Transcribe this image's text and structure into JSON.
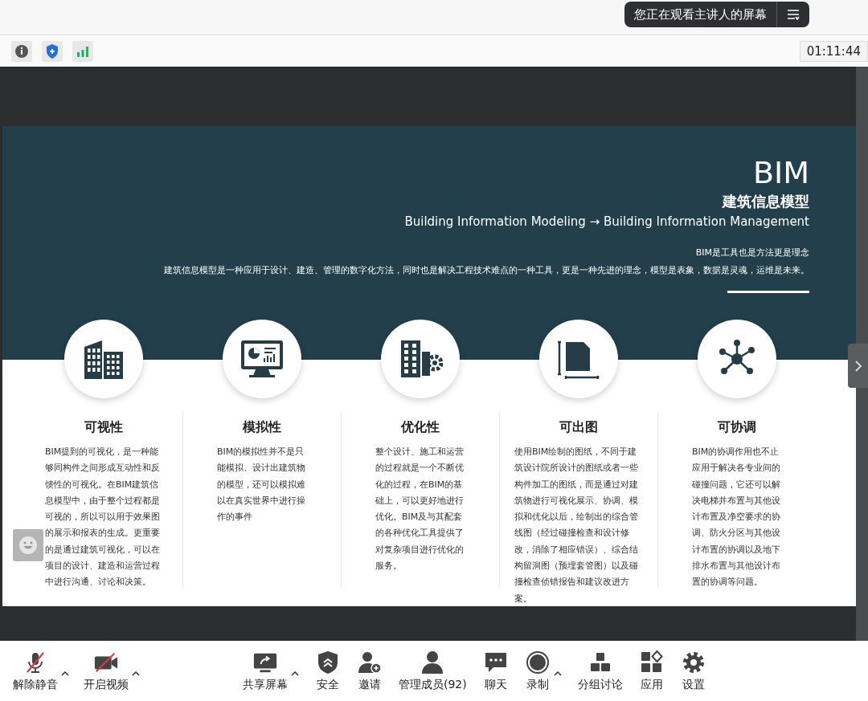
{
  "banner": {
    "text": "您正在观看主讲人的屏幕"
  },
  "timer": "01:11:44",
  "slide": {
    "title": "BIM",
    "subtitle": "建筑信息模型",
    "tagline": "Building Information Modeling → Building Information Management",
    "motto": "BIM是工具也是方法更是理念",
    "description": "建筑信息模型是一种应用于设计、建造、管理的数字化方法，同时也是解决工程技术难点的一种工具，更是一种先进的理念，模型是表象，数据是灵魂，运维是未来。",
    "features": [
      {
        "kind": "buildings",
        "title": "可视性",
        "text": "BIM提到的可视化，是一种能够同构件之间形成互动性和反馈性的可视化。在BIM建筑信息模型中，由于整个过程都是可视的，所以可以用于效果图的展示和报表的生成。更重要的是通过建筑可视化，可以在项目的设计、建造和运营过程中进行沟通、讨论和决策。"
      },
      {
        "kind": "monitor",
        "title": "模拟性",
        "text": "BIM的模拟性并不是只能模拟、设计出建筑物的模型，还可以模拟难以在真实世界中进行操作的事件"
      },
      {
        "kind": "building-gear",
        "title": "优化性",
        "text": "整个设计、施工和运营的过程就是一个不断优化的过程，在BIM的基础上，可以更好地进行优化。BIM及与其配套的各种优化工具提供了对复杂项目进行优化的服务。"
      },
      {
        "kind": "drawing",
        "title": "可出图",
        "text": "使用BIM绘制的图纸，不同于建筑设计院所设计的图纸或者一些构件加工的图纸，而是通过对建筑物进行可视化展示、协调、模拟和优化以后，绘制出的综合管线图（经过碰撞检查和设计修改，消除了相应错误）、综合结构留洞图（预埋套管图）以及碰撞检查侦错报告和建议改进方案。"
      },
      {
        "kind": "network",
        "title": "可协调",
        "text": "BIM的协调作用也不止应用于解决各专业间的碰撞问题，它还可以解决电梯井布置与其他设计布置及净空要求的协调、防火分区与其他设计布置的协调以及地下排水布置与其他设计布置的协调等问题。"
      }
    ]
  },
  "toolbar": [
    {
      "kind": "mic",
      "label": "解除静音",
      "has_menu": true
    },
    {
      "kind": "video",
      "label": "开启视频",
      "has_menu": true
    },
    {
      "kind": "share",
      "label": "共享屏幕",
      "has_menu": true
    },
    {
      "kind": "security",
      "label": "安全",
      "has_menu": false
    },
    {
      "kind": "invite",
      "label": "邀请",
      "has_menu": false
    },
    {
      "kind": "members",
      "label": "管理成员(92)",
      "has_menu": false
    },
    {
      "kind": "chat",
      "label": "聊天",
      "has_menu": false
    },
    {
      "kind": "record",
      "label": "录制",
      "has_menu": true
    },
    {
      "kind": "breakout",
      "label": "分组讨论",
      "has_menu": false
    },
    {
      "kind": "apps",
      "label": "应用",
      "has_menu": false
    },
    {
      "kind": "settings",
      "label": "设置",
      "has_menu": false
    }
  ]
}
